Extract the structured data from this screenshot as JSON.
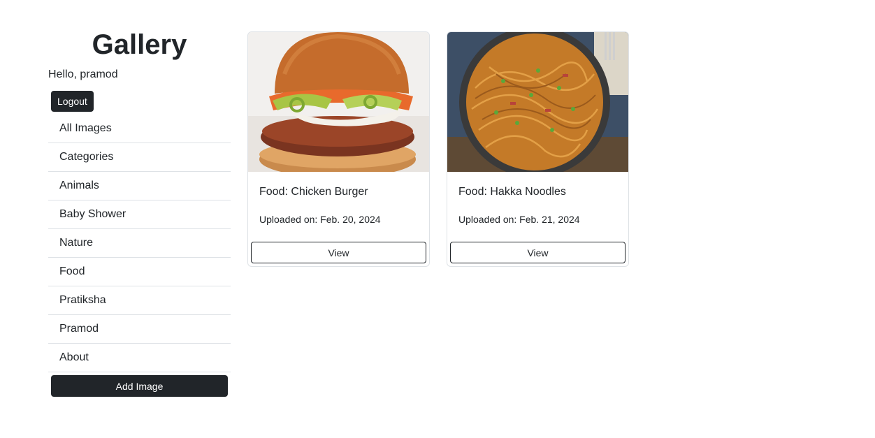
{
  "header": {
    "title": "Gallery",
    "greeting": "Hello, pramod",
    "logout_label": "Logout"
  },
  "sidebar": {
    "items": [
      {
        "label": "All Images"
      },
      {
        "label": "Categories"
      },
      {
        "label": "Animals"
      },
      {
        "label": "Baby Shower"
      },
      {
        "label": "Nature"
      },
      {
        "label": "Food"
      },
      {
        "label": "Pratiksha"
      },
      {
        "label": "Pramod"
      },
      {
        "label": "About"
      }
    ],
    "add_label": "Add Image"
  },
  "cards": [
    {
      "title": "Food: Chicken Burger",
      "date": "Uploaded on: Feb. 20, 2024",
      "button": "View"
    },
    {
      "title": "Food: Hakka Noodles",
      "date": "Uploaded on: Feb. 21, 2024",
      "button": "View"
    }
  ],
  "colors": {
    "dark": "#212529",
    "border": "#dee2e6"
  }
}
